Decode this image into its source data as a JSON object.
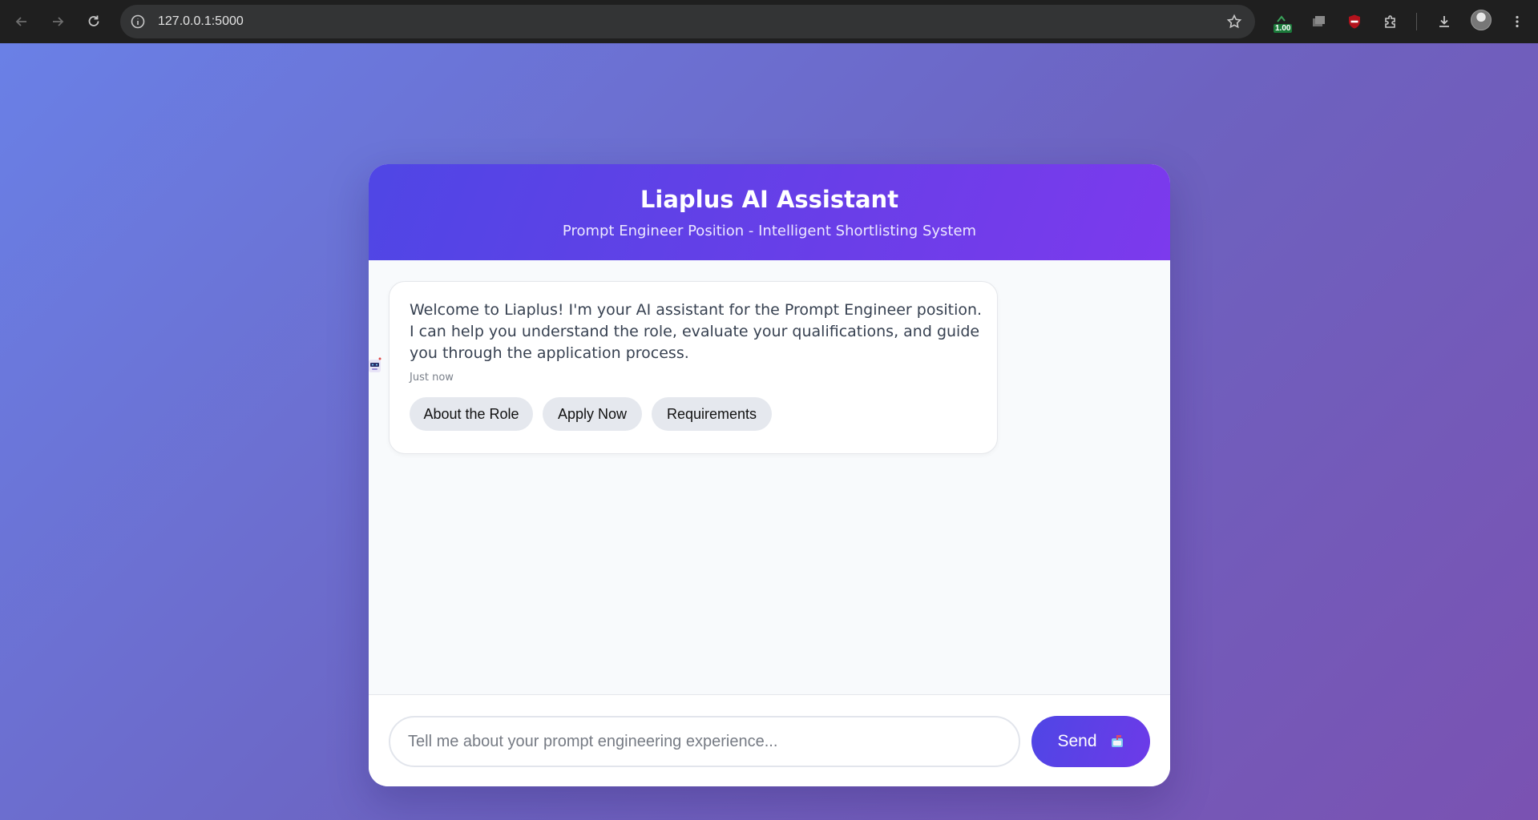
{
  "browser": {
    "url": "127.0.0.1:5000",
    "extension_badge": "1.00"
  },
  "chat": {
    "title": "Liaplus AI Assistant",
    "subtitle": "Prompt Engineer Position - Intelligent Shortlisting System",
    "messages": [
      {
        "sender": "bot",
        "text": "Welcome to Liaplus! I'm your AI assistant for the Prompt Engineer position. I can help you understand the role, evaluate your qualifications, and guide you through the application process.",
        "time": "Just now",
        "quick_replies": [
          "About the Role",
          "Apply Now",
          "Requirements"
        ]
      }
    ],
    "input_placeholder": "Tell me about your prompt engineering experience...",
    "send_label": "Send"
  },
  "colors": {
    "header_start": "#4f46e5",
    "header_end": "#7c3aed",
    "page_bg_start": "#6a80e6",
    "page_bg_end": "#7a52b2"
  }
}
